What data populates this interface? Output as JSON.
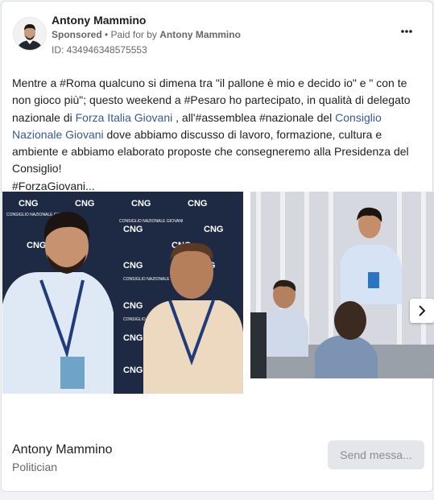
{
  "ad": {
    "author": "Antony Mammino",
    "sponsored": "Sponsored",
    "paid_for_prefix": " • Paid for by ",
    "paid_for_name": "Antony Mammino",
    "id_text": "ID: 434946348575553"
  },
  "post": {
    "t1": "Mentre a #Roma qualcuno si dimena tra \"il pallone è mio e decido io\" e \" con te non gioco più\"; questo weekend a #Pesaro ho partecipato, in qualità di delegato nazionale di ",
    "link1": "Forza Italia Giovani",
    "t2": " , all'#assemblea #nazionale del ",
    "link2": "Consiglio Nazionale Giovani",
    "t3": " dove abbiamo discusso di lavoro, formazione, cultura e ambiente e abbiamo elaborato proposte che consegneremo alla Presidenza del Consiglio!",
    "t4": "#ForzaGiovani..."
  },
  "backdrop_logo": "CNG",
  "backdrop_text": "CONSIGLIO NAZIONALE GIOVANI",
  "footer": {
    "name": "Antony Mammino",
    "role": "Politician",
    "send_label": "Send messa..."
  },
  "icons": {
    "menu": "more-horizontal-icon",
    "next": "chevron-right-icon"
  }
}
